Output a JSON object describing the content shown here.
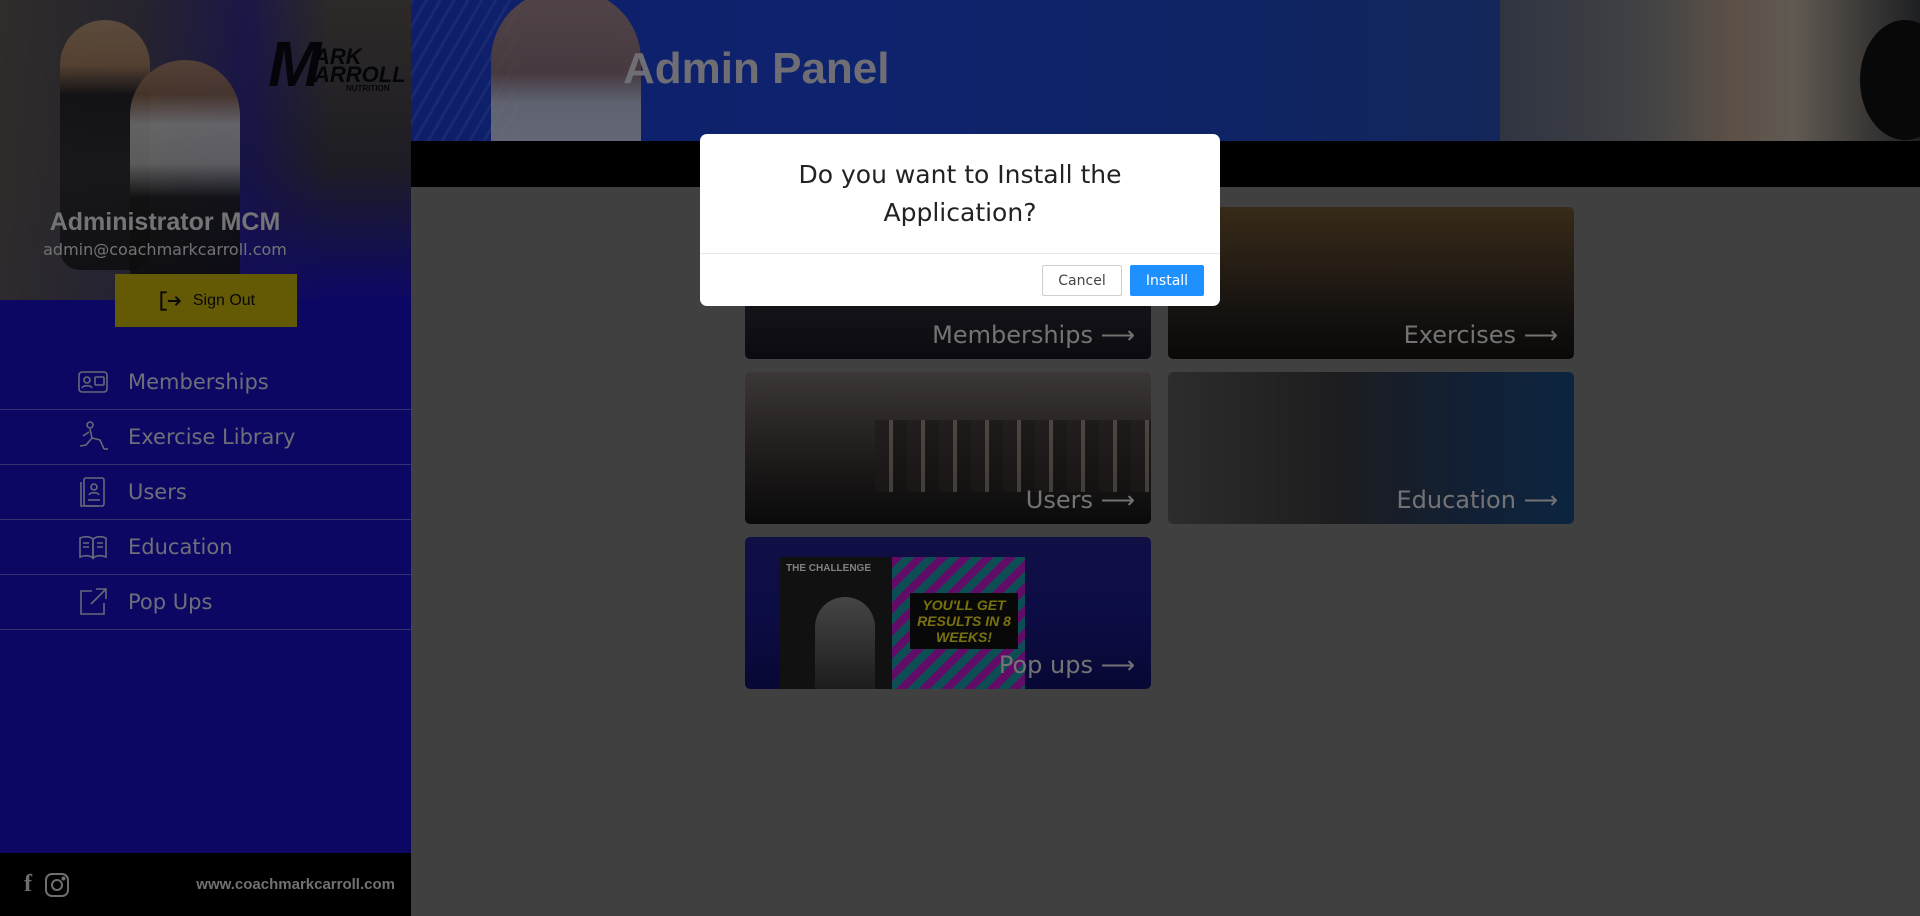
{
  "sidebar": {
    "logo_text": "MARK CARROLL NUTRITION",
    "admin_name": "Administrator MCM",
    "admin_email": "admin@coachmarkcarroll.com",
    "signout_label": "Sign Out",
    "nav": [
      {
        "label": "Memberships",
        "icon": "membership-card-icon"
      },
      {
        "label": "Exercise Library",
        "icon": "exercise-lunge-icon"
      },
      {
        "label": "Users",
        "icon": "user-id-icon"
      },
      {
        "label": "Education",
        "icon": "book-icon"
      },
      {
        "label": "Pop Ups",
        "icon": "external-link-icon"
      }
    ],
    "footer": {
      "website": "www.coachmarkcarroll.com",
      "social_icons": [
        "facebook-icon",
        "instagram-icon"
      ]
    }
  },
  "header": {
    "title": "Admin Panel"
  },
  "tiles": [
    {
      "label": "Memberships ⟶"
    },
    {
      "label": "Exercises ⟶"
    },
    {
      "label": "Users ⟶"
    },
    {
      "label": "Education ⟶"
    },
    {
      "label": "Pop ups ⟶"
    }
  ],
  "popup_poster": {
    "tag": "THE CHALLENGE",
    "headline": "YOU'LL GET RESULTS IN 8 WEEKS!"
  },
  "modal": {
    "title": "Do you want to Install the Application?",
    "cancel_label": "Cancel",
    "install_label": "Install"
  },
  "colors": {
    "sidebar_bg": "#1a0fc9",
    "signout_bg": "#c8b40a",
    "install_button": "#1e90ff",
    "footer_bg": "#000000"
  }
}
